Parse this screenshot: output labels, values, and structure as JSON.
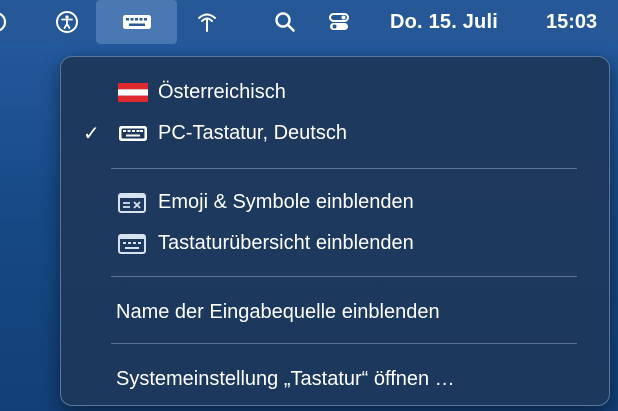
{
  "menubar": {
    "icons": [
      "partial-icon",
      "accessibility-icon",
      "keyboard-icon",
      "wifi-icon",
      "search-icon",
      "control-center-icon"
    ],
    "date": "Do. 15. Juli",
    "time": "15:03"
  },
  "menu": {
    "items": [
      {
        "label": "Österreichisch",
        "icon": "austria-flag-icon",
        "checked": false
      },
      {
        "label": "PC-Tastatur, Deutsch",
        "icon": "keyboard-icon",
        "checked": true,
        "check": "✓"
      },
      {
        "label": "Emoji & Symbole einblenden",
        "icon": "emoji-viewer-icon"
      },
      {
        "label": "Tastaturübersicht einblenden",
        "icon": "keyboard-viewer-icon"
      },
      {
        "label": "Name der Eingabequelle einblenden"
      },
      {
        "label": "Systemeinstellung „Tastatur“ öffnen …"
      }
    ]
  },
  "colors": {
    "menu_bg": "#1e385c",
    "flag_red": "#e0292e",
    "flag_white": "#ffffff"
  }
}
